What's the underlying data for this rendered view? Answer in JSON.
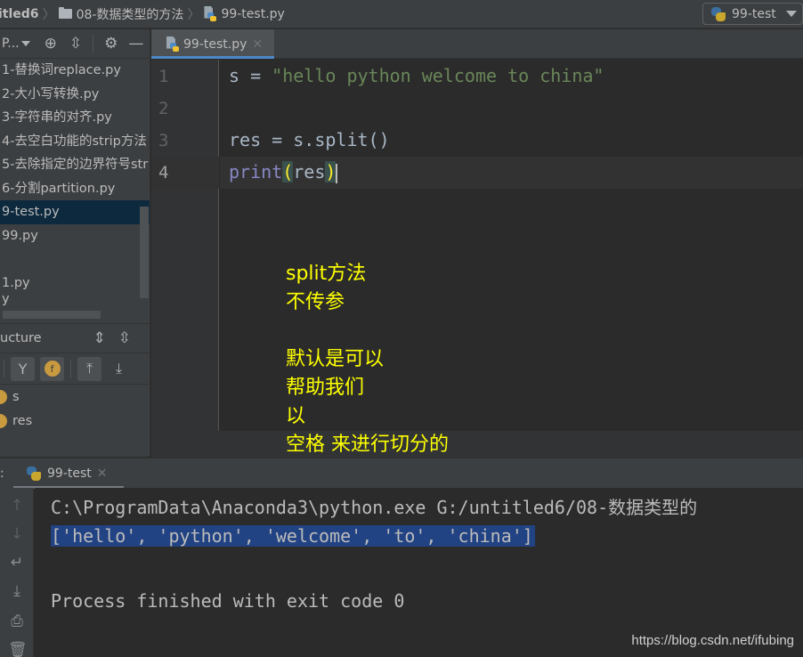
{
  "navbar": {
    "breadcrumbs": [
      "itled6",
      "08-数据类型的方法",
      "99-test.py"
    ],
    "run_config": "99-test"
  },
  "project_panel": {
    "view_label": "P...",
    "files": [
      "1-替换词replace.py",
      "2-大小写转换.py",
      "3-字符串的对齐.py",
      "4-去空白功能的strip方法",
      "5-去除指定的边界符号str",
      "6-分割partition.py",
      "9-test.py",
      "99.py",
      "",
      "1.py",
      "y"
    ],
    "selected_index": 6
  },
  "structure_panel": {
    "title": "ucture",
    "items": [
      {
        "badge": "v",
        "name": "s"
      },
      {
        "badge": "v",
        "name": "res"
      }
    ],
    "function_badge": "f"
  },
  "editor": {
    "tab_label": "99-test.py",
    "line_numbers": [
      "1",
      "2",
      "3",
      "4"
    ],
    "lines": {
      "l1_var": "s = ",
      "l1_str": "\"hello python welcome to china\"",
      "l3": "res = s.split()",
      "l4_builtin": "print",
      "l4_open": "(",
      "l4_arg": "res",
      "l4_close": ")"
    },
    "annotation": [
      "split方法",
      "不传参",
      "",
      "默认是可以",
      "帮助我们",
      "以",
      "空格 来进行切分的"
    ]
  },
  "run_panel": {
    "label_prefix": ":",
    "tab_label": "99-test",
    "console": [
      "C:\\ProgramData\\Anaconda3\\python.exe G:/untitled6/08-数据类型的",
      "['hello', 'python', 'welcome', 'to', 'china']",
      "",
      "Process finished with exit code 0"
    ]
  },
  "watermark": "https://blog.csdn.net/ifubing",
  "colors": {
    "accent": "#4a88c7",
    "selection": "#214283",
    "string": "#6a8759",
    "builtin": "#8888c6",
    "annotation": "#ffff00"
  }
}
